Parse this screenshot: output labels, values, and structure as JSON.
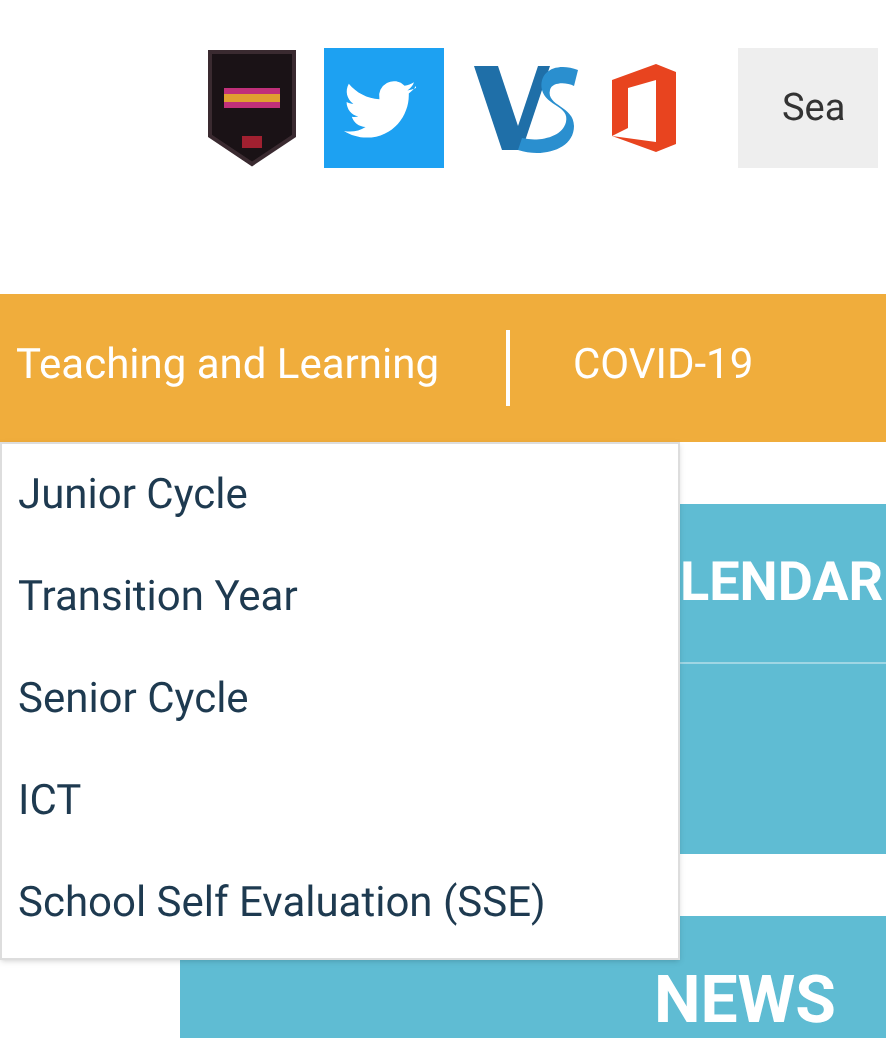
{
  "header": {
    "search": {
      "placeholder": "Sea"
    }
  },
  "nav": {
    "items": [
      {
        "label": "Teaching and Learning"
      },
      {
        "label": "COVID-19"
      }
    ]
  },
  "dropdown": {
    "items": [
      "Junior Cycle",
      "Transition Year",
      "Senior Cycle",
      "ICT",
      "School Self Evaluation (SSE)"
    ]
  },
  "panels": [
    {
      "title": "LENDAR"
    },
    {
      "title": "NEWS"
    }
  ]
}
